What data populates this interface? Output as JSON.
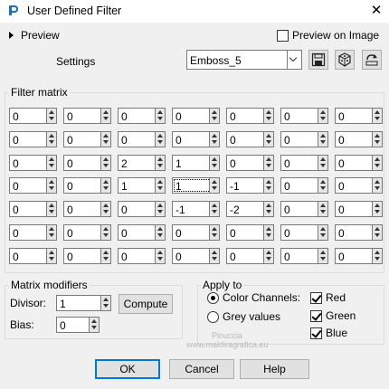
{
  "window": {
    "title": "User Defined Filter",
    "close_glyph": "✕"
  },
  "preview": {
    "label": "Preview",
    "preview_on_image_label": "Preview on Image",
    "preview_on_image_checked": false
  },
  "settings": {
    "label": "Settings",
    "preset_value": "Emboss_5"
  },
  "toolbar_icons": [
    "save-preset-icon",
    "randomize-icon",
    "reset-icon"
  ],
  "filter_matrix": {
    "title": "Filter matrix",
    "rows": [
      [
        "0",
        "0",
        "0",
        "0",
        "0",
        "0",
        "0"
      ],
      [
        "0",
        "0",
        "0",
        "0",
        "0",
        "0",
        "0"
      ],
      [
        "0",
        "0",
        "2",
        "1",
        "0",
        "0",
        "0"
      ],
      [
        "0",
        "0",
        "1",
        "1",
        "-1",
        "0",
        "0"
      ],
      [
        "0",
        "0",
        "0",
        "-1",
        "-2",
        "0",
        "0"
      ],
      [
        "0",
        "0",
        "0",
        "0",
        "0",
        "0",
        "0"
      ],
      [
        "0",
        "0",
        "0",
        "0",
        "0",
        "0",
        "0"
      ]
    ]
  },
  "matrix_modifiers": {
    "title": "Matrix modifiers",
    "divisor_label": "Divisor:",
    "divisor_value": "1",
    "compute_label": "Compute",
    "bias_label": "Bias:",
    "bias_value": "0"
  },
  "apply_to": {
    "title": "Apply to",
    "color_channels_label": "Color Channels:",
    "color_channels_selected": true,
    "grey_values_label": "Grey values",
    "grey_values_selected": false,
    "red_label": "Red",
    "red_checked": true,
    "green_label": "Green",
    "green_checked": true,
    "blue_label": "Blue",
    "blue_checked": true
  },
  "watermark": {
    "line1": "Pinuccia",
    "line2": "www.maldiragrafica.eu"
  },
  "buttons": {
    "ok": "OK",
    "cancel": "Cancel",
    "help": "Help"
  },
  "colors": {
    "accent": "#0078d7",
    "background": "#f0f0f0"
  }
}
